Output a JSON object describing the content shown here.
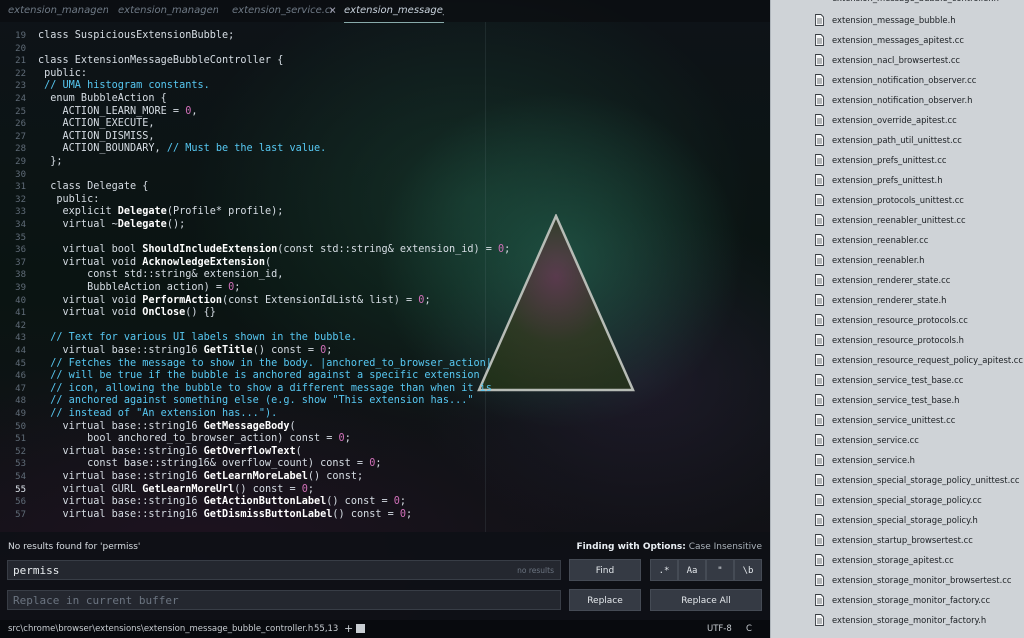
{
  "tabs": [
    {
      "label": "extension_management",
      "active": false
    },
    {
      "label": "extension_management",
      "active": false
    },
    {
      "label": "extension_service.cc",
      "active": false
    },
    {
      "label": "extension_message_...",
      "active": true
    }
  ],
  "code_lines": [
    {
      "n": "19",
      "t": "class SuspiciousExtensionBubble;"
    },
    {
      "n": "20",
      "t": ""
    },
    {
      "n": "21",
      "t": "class ExtensionMessageBubbleController {"
    },
    {
      "n": "22",
      "t": " public:"
    },
    {
      "n": "23",
      "t": " // UMA histogram constants."
    },
    {
      "n": "24",
      "t": "  enum BubbleAction {"
    },
    {
      "n": "25",
      "t": "    ACTION_LEARN_MORE = 0,"
    },
    {
      "n": "26",
      "t": "    ACTION_EXECUTE,"
    },
    {
      "n": "27",
      "t": "    ACTION_DISMISS,"
    },
    {
      "n": "28",
      "t": "    ACTION_BOUNDARY, // Must be the last value."
    },
    {
      "n": "29",
      "t": "  };"
    },
    {
      "n": "30",
      "t": ""
    },
    {
      "n": "31",
      "t": "  class Delegate {"
    },
    {
      "n": "32",
      "t": "   public:"
    },
    {
      "n": "33",
      "t": "    explicit Delegate(Profile* profile);"
    },
    {
      "n": "34",
      "t": "    virtual ~Delegate();"
    },
    {
      "n": "35",
      "t": ""
    },
    {
      "n": "36",
      "t": "    virtual bool ShouldIncludeExtension(const std::string& extension_id) = 0;"
    },
    {
      "n": "37",
      "t": "    virtual void AcknowledgeExtension("
    },
    {
      "n": "38",
      "t": "        const std::string& extension_id,"
    },
    {
      "n": "39",
      "t": "        BubbleAction action) = 0;"
    },
    {
      "n": "40",
      "t": "    virtual void PerformAction(const ExtensionIdList& list) = 0;"
    },
    {
      "n": "41",
      "t": "    virtual void OnClose() {}"
    },
    {
      "n": "42",
      "t": ""
    },
    {
      "n": "43",
      "t": "  // Text for various UI labels shown in the bubble."
    },
    {
      "n": "44",
      "t": "    virtual base::string16 GetTitle() const = 0;"
    },
    {
      "n": "45",
      "t": "  // Fetches the message to show in the body. |anchored_to_browser_action|"
    },
    {
      "n": "46",
      "t": "  // will be true if the bubble is anchored against a specific extension"
    },
    {
      "n": "47",
      "t": "  // icon, allowing the bubble to show a different message than when it is"
    },
    {
      "n": "48",
      "t": "  // anchored against something else (e.g. show \"This extension has...\""
    },
    {
      "n": "49",
      "t": "  // instead of \"An extension has...\")."
    },
    {
      "n": "50",
      "t": "    virtual base::string16 GetMessageBody("
    },
    {
      "n": "51",
      "t": "        bool anchored_to_browser_action) const = 0;"
    },
    {
      "n": "52",
      "t": "    virtual base::string16 GetOverflowText("
    },
    {
      "n": "53",
      "t": "        const base::string16& overflow_count) const = 0;"
    },
    {
      "n": "54",
      "t": "    virtual base::string16 GetLearnMoreLabel() const;"
    },
    {
      "n": "55",
      "t": "    virtual GURL GetLearnMoreUrl() const = 0;"
    },
    {
      "n": "56",
      "t": "    virtual base::string16 GetActionButtonLabel() const = 0;"
    },
    {
      "n": "57",
      "t": "    virtual base::string16 GetDismissButtonLabel() const = 0;"
    }
  ],
  "current_line": "55",
  "find": {
    "status": "No results found for 'permiss'",
    "options_label": "Finding with Options:",
    "options_value": "Case Insensitive",
    "query": "permiss",
    "no_results_hint": "no results",
    "replace_placeholder": "Replace in current buffer",
    "find_button": "Find",
    "replace_button": "Replace",
    "replace_all_button": "Replace All",
    "toggle_regex": ".*",
    "toggle_case": "Aa",
    "toggle_selection": "\"",
    "toggle_word": "\\b"
  },
  "status_bar": {
    "path": "src\\chrome\\browser\\extensions\\extension_message_bubble_controller.h",
    "cursor": "55,13",
    "encoding": "UTF-8",
    "grammar": "C"
  },
  "sidebar": {
    "files": [
      "extension_message_bubble_controller.h",
      "extension_message_bubble.h",
      "extension_messages_apitest.cc",
      "extension_nacl_browsertest.cc",
      "extension_notification_observer.cc",
      "extension_notification_observer.h",
      "extension_override_apitest.cc",
      "extension_path_util_unittest.cc",
      "extension_prefs_unittest.cc",
      "extension_prefs_unittest.h",
      "extension_protocols_unittest.cc",
      "extension_reenabler_unittest.cc",
      "extension_reenabler.cc",
      "extension_reenabler.h",
      "extension_renderer_state.cc",
      "extension_renderer_state.h",
      "extension_resource_protocols.cc",
      "extension_resource_protocols.h",
      "extension_resource_request_policy_apitest.cc",
      "extension_service_test_base.cc",
      "extension_service_test_base.h",
      "extension_service_unittest.cc",
      "extension_service.cc",
      "extension_service.h",
      "extension_special_storage_policy_unittest.cc",
      "extension_special_storage_policy.cc",
      "extension_special_storage_policy.h",
      "extension_startup_browsertest.cc",
      "extension_storage_apitest.cc",
      "extension_storage_monitor_browsertest.cc",
      "extension_storage_monitor_factory.cc",
      "extension_storage_monitor_factory.h"
    ]
  }
}
